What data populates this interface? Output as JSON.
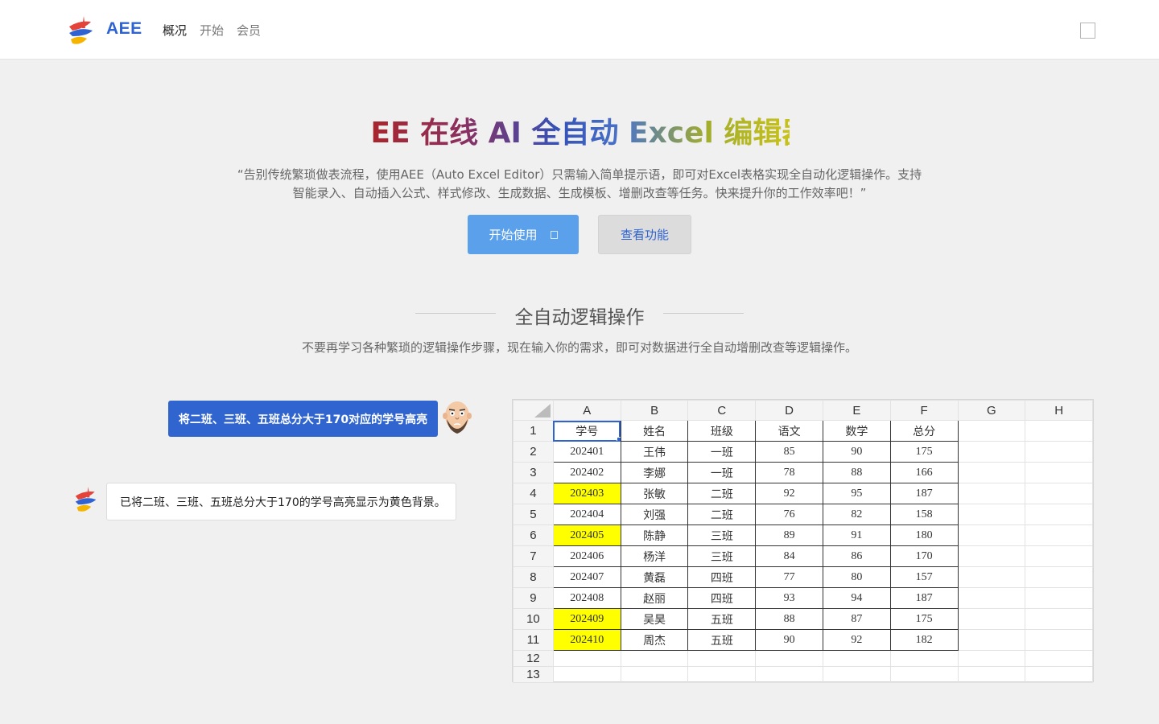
{
  "header": {
    "brand": "AEE",
    "nav": [
      {
        "label": "概况",
        "active": true
      },
      {
        "label": "开始",
        "active": false
      },
      {
        "label": "会员",
        "active": false
      }
    ]
  },
  "hero": {
    "title": "AEE 在线 AI 全自动 Excel 编辑器",
    "description": "“告别传统繁琐做表流程，使用AEE（Auto Excel Editor）只需输入简单提示语，即可对Excel表格实现全自动化逻辑操作。支持智能录入、自动插入公式、样式修改、生成数据、生成模板、增删改查等任务。快来提升你的工作效率吧！”",
    "start_label": "开始使用",
    "features_label": "查看功能"
  },
  "section": {
    "title": "全自动逻辑操作",
    "description": "不要再学习各种繁琐的逻辑操作步骤，现在输入你的需求，即可对数据进行全自动增删改查等逻辑操作。"
  },
  "chat": {
    "user_message": "将二班、三班、五班总分大于170对应的学号高亮",
    "bot_message": "已将二班、三班、五班总分大于170的学号高亮显示为黄色背景。"
  },
  "sheet": {
    "columns": [
      "A",
      "B",
      "C",
      "D",
      "E",
      "F",
      "G",
      "H"
    ],
    "row_numbers": [
      "1",
      "2",
      "3",
      "4",
      "5",
      "6",
      "7",
      "8",
      "9",
      "10",
      "11",
      "12",
      "13"
    ],
    "header_row": [
      "学号",
      "姓名",
      "班级",
      "语文",
      "数学",
      "总分"
    ],
    "rows": [
      [
        "202401",
        "王伟",
        "一班",
        "85",
        "90",
        "175"
      ],
      [
        "202402",
        "李娜",
        "一班",
        "78",
        "88",
        "166"
      ],
      [
        "202403",
        "张敏",
        "二班",
        "92",
        "95",
        "187"
      ],
      [
        "202404",
        "刘强",
        "二班",
        "76",
        "82",
        "158"
      ],
      [
        "202405",
        "陈静",
        "三班",
        "89",
        "91",
        "180"
      ],
      [
        "202406",
        "杨洋",
        "三班",
        "84",
        "86",
        "170"
      ],
      [
        "202407",
        "黄磊",
        "四班",
        "77",
        "80",
        "157"
      ],
      [
        "202408",
        "赵丽",
        "四班",
        "93",
        "94",
        "187"
      ],
      [
        "202409",
        "吴昊",
        "五班",
        "88",
        "87",
        "175"
      ],
      [
        "202410",
        "周杰",
        "五班",
        "90",
        "92",
        "182"
      ]
    ],
    "highlighted_rows": [
      2,
      4,
      8,
      9
    ],
    "highlight_color": "#ffff00"
  },
  "colors": {
    "brand_blue": "#2f63d1",
    "start_button": "#5aa0ea"
  }
}
